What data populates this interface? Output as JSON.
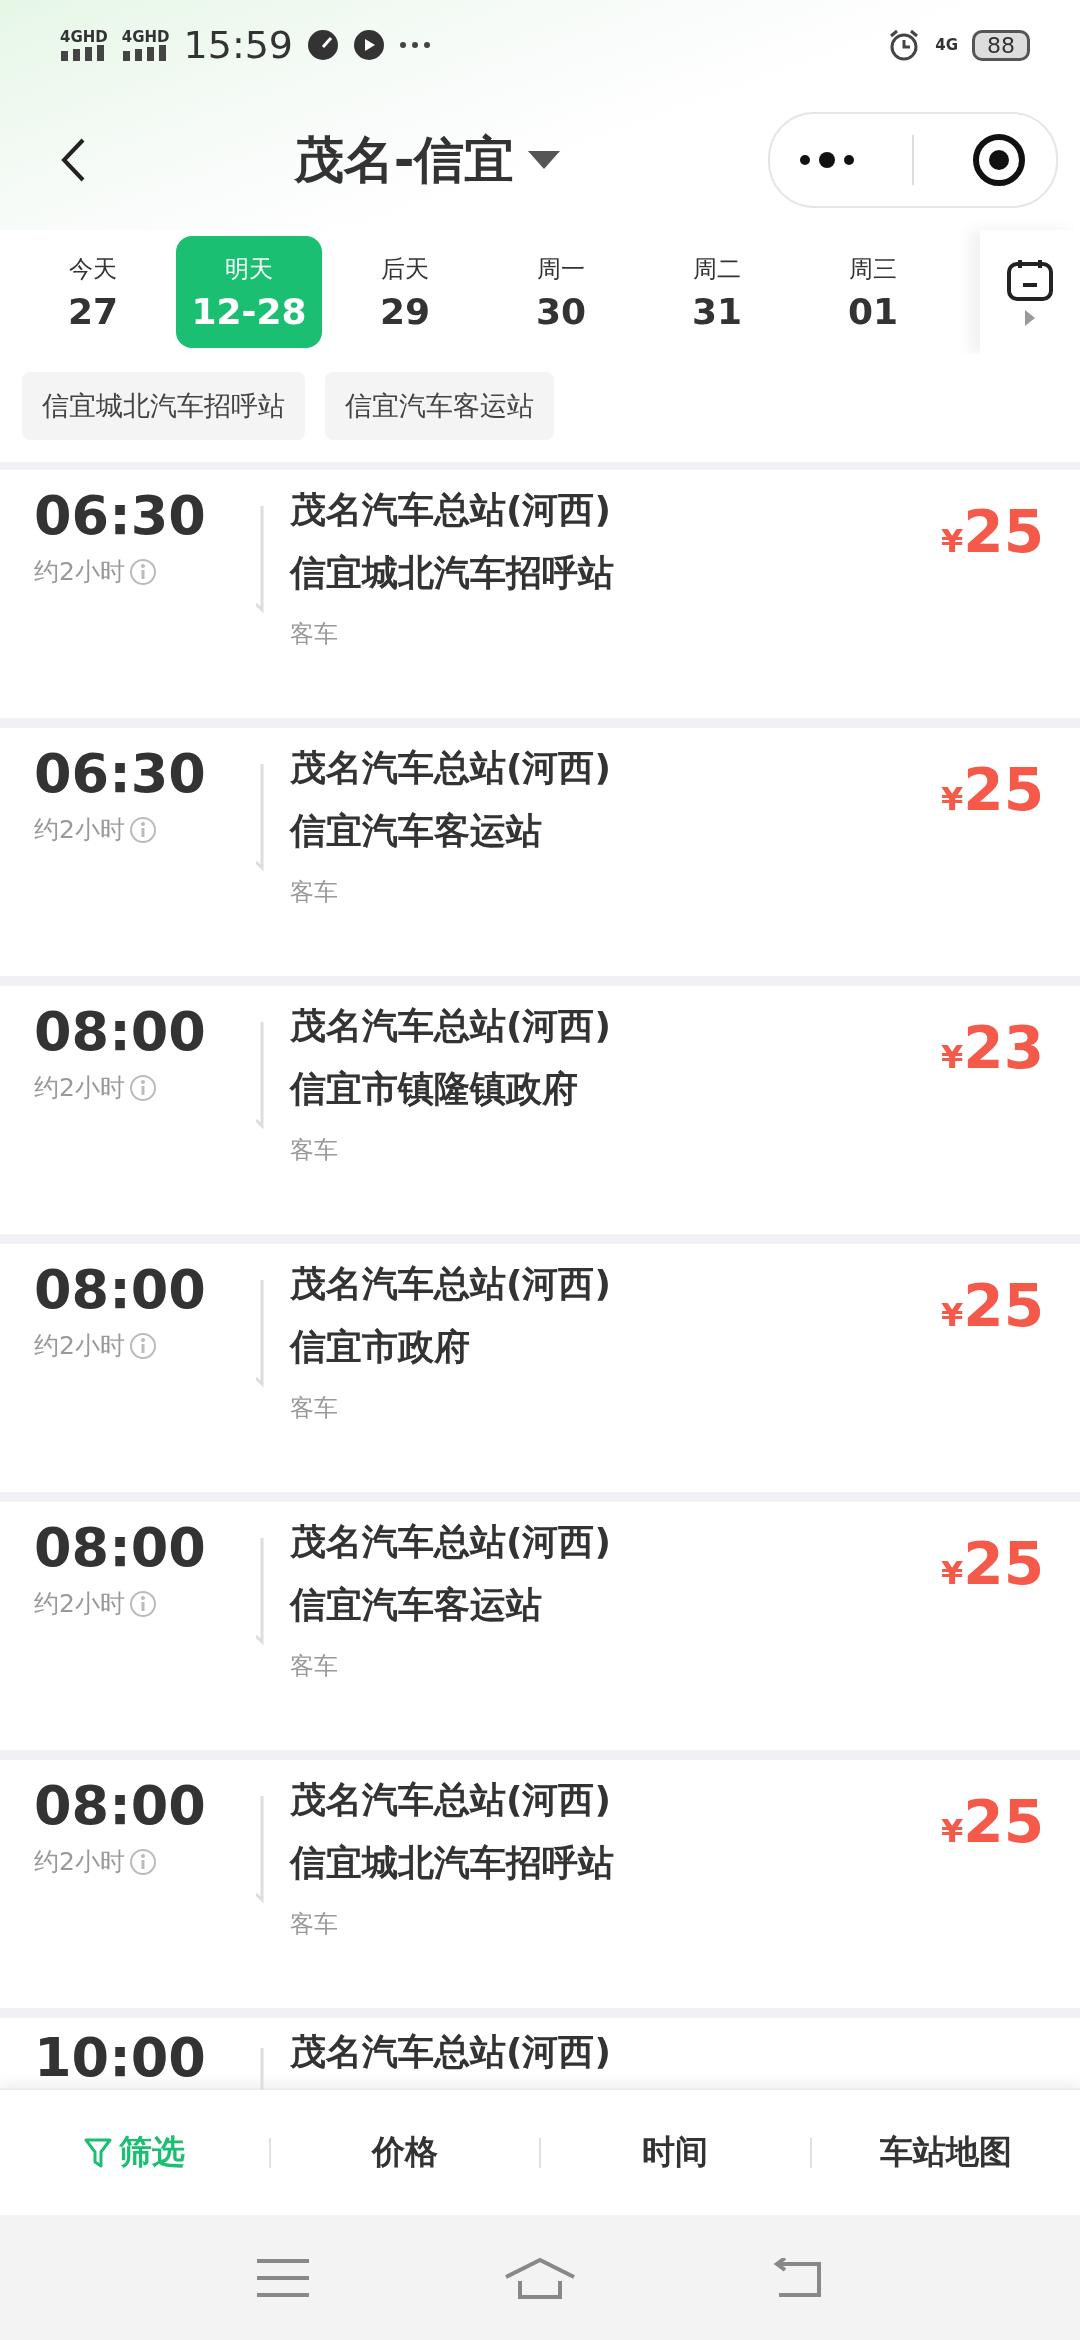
{
  "status_bar": {
    "networks": [
      "4GHD",
      "4GHD"
    ],
    "time": "15:59",
    "right_network": "4G",
    "battery": "88"
  },
  "header": {
    "title": "茂名-信宜"
  },
  "dates": [
    {
      "weekday": "今天",
      "day": "27",
      "selected": false
    },
    {
      "weekday": "明天",
      "day": "12-28",
      "selected": true
    },
    {
      "weekday": "后天",
      "day": "29",
      "selected": false
    },
    {
      "weekday": "周一",
      "day": "30",
      "selected": false
    },
    {
      "weekday": "周二",
      "day": "31",
      "selected": false
    },
    {
      "weekday": "周三",
      "day": "01",
      "selected": false
    }
  ],
  "stations": [
    "信宜城北汽车招呼站",
    "信宜汽车客运站"
  ],
  "trips": [
    {
      "time": "06:30",
      "duration": "约2小时",
      "from": "茂名汽车总站(河西)",
      "to": "信宜城北汽车招呼站",
      "type": "客车",
      "currency": "¥",
      "price": "25"
    },
    {
      "time": "06:30",
      "duration": "约2小时",
      "from": "茂名汽车总站(河西)",
      "to": "信宜汽车客运站",
      "type": "客车",
      "currency": "¥",
      "price": "25"
    },
    {
      "time": "08:00",
      "duration": "约2小时",
      "from": "茂名汽车总站(河西)",
      "to": "信宜市镇隆镇政府",
      "type": "客车",
      "currency": "¥",
      "price": "23"
    },
    {
      "time": "08:00",
      "duration": "约2小时",
      "from": "茂名汽车总站(河西)",
      "to": "信宜市政府",
      "type": "客车",
      "currency": "¥",
      "price": "25"
    },
    {
      "time": "08:00",
      "duration": "约2小时",
      "from": "茂名汽车总站(河西)",
      "to": "信宜汽车客运站",
      "type": "客车",
      "currency": "¥",
      "price": "25"
    },
    {
      "time": "08:00",
      "duration": "约2小时",
      "from": "茂名汽车总站(河西)",
      "to": "信宜城北汽车招呼站",
      "type": "客车",
      "currency": "¥",
      "price": "25"
    },
    {
      "time": "10:00",
      "from": "茂名汽车总站(河西)"
    }
  ],
  "bottom_tabs": [
    {
      "label": "筛选",
      "selected": true
    },
    {
      "label": "价格",
      "selected": false
    },
    {
      "label": "时间",
      "selected": false
    },
    {
      "label": "车站地图",
      "selected": false
    }
  ]
}
